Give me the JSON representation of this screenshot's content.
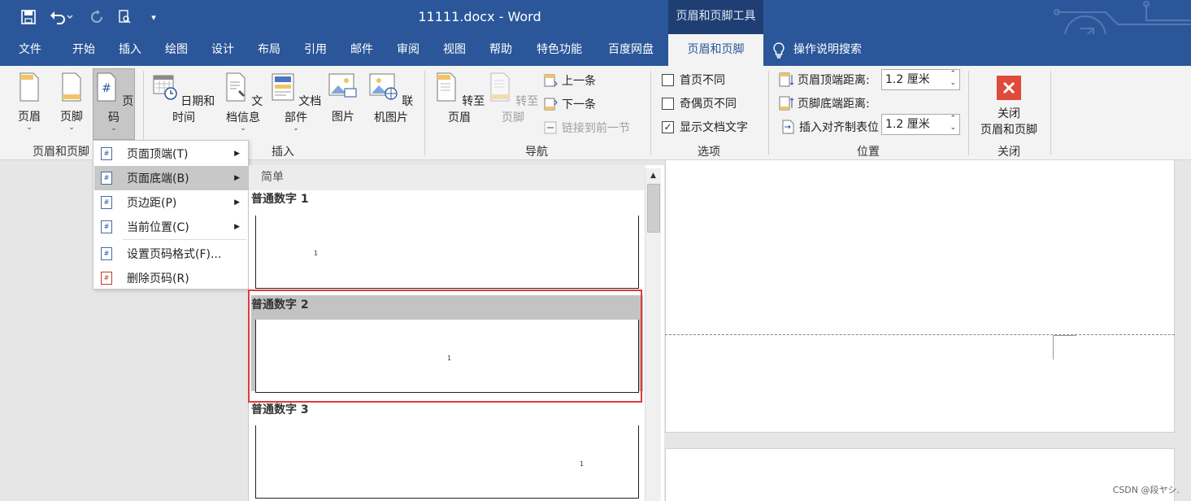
{
  "window": {
    "title": "11111.docx  -  Word",
    "context_tab_group": "页眉和页脚工具"
  },
  "tabs": [
    "文件",
    "开始",
    "插入",
    "绘图",
    "设计",
    "布局",
    "引用",
    "邮件",
    "审阅",
    "视图",
    "帮助",
    "特色功能",
    "百度网盘",
    "页眉和页脚"
  ],
  "active_tab": "页眉和页脚",
  "search": {
    "label": "操作说明搜索"
  },
  "ribbon": {
    "group_header_footer": {
      "label": "页眉和页脚",
      "buttons": [
        "页眉",
        "页脚",
        "页码"
      ]
    },
    "group_insert": {
      "label": "插入",
      "buttons": [
        "日期和时间",
        "文档信息",
        "文档部件",
        "图片",
        "联机图片"
      ]
    },
    "group_nav": {
      "label": "导航",
      "goto_header": "转至页眉",
      "goto_footer": "转至页脚",
      "prev": "上一条",
      "next": "下一条",
      "link_prev": "链接到前一节"
    },
    "group_options": {
      "label": "选项",
      "first_page_diff": "首页不同",
      "odd_even_diff": "奇偶页不同",
      "show_doc_text": "显示文档文字"
    },
    "group_position": {
      "label": "位置",
      "header_dist_label": "页眉顶端距离:",
      "header_dist_value": "1.2 厘米",
      "footer_dist_label": "页脚底端距离:",
      "footer_dist_value": "1.2 厘米",
      "insert_tab": "插入对齐制表位"
    },
    "group_close": {
      "label": "关闭",
      "button_line1": "关闭",
      "button_line2": "页眉和页脚"
    }
  },
  "page_number_menu": {
    "items": [
      {
        "label": "页面顶端(T)",
        "has_submenu": true
      },
      {
        "label": "页面底端(B)",
        "has_submenu": true
      },
      {
        "label": "页边距(P)",
        "has_submenu": true
      },
      {
        "label": "当前位置(C)",
        "has_submenu": true
      },
      {
        "label": "设置页码格式(F)...",
        "has_submenu": false
      },
      {
        "label": "删除页码(R)",
        "has_submenu": false
      }
    ]
  },
  "gallery": {
    "section": "简单",
    "items": [
      {
        "title": "普通数字 1",
        "sample": "1"
      },
      {
        "title": "普通数字 2",
        "sample": "1"
      },
      {
        "title": "普通数字 3",
        "sample": "1"
      }
    ]
  },
  "watermark": "CSDN @段ヤシ.",
  "colors": {
    "accent": "#2b579a",
    "highlight": "#e03a3a",
    "close_red": "#e04a3a"
  }
}
